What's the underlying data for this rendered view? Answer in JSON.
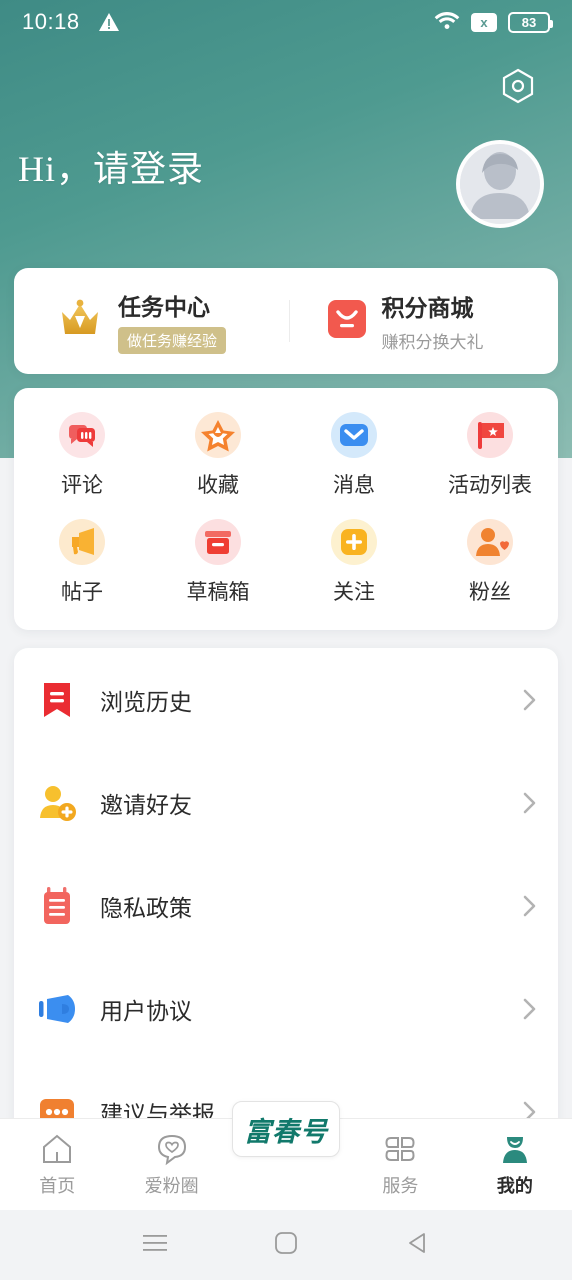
{
  "statusbar": {
    "time": "10:18",
    "warning_icon": "warning-triangle-icon",
    "wifi_icon": "wifi-icon",
    "nosim_label": "x",
    "battery_level": "83"
  },
  "header": {
    "settings_icon": "settings-hexagon-icon",
    "greeting": "Hi，请登录",
    "avatar_icon": "default-avatar-icon",
    "bg_color": "#4e9a90"
  },
  "task_card": {
    "left": {
      "icon": "crown-icon",
      "title": "任务中心",
      "badge": "做任务赚经验"
    },
    "right": {
      "icon": "points-shop-icon",
      "title": "积分商城",
      "subtitle": "赚积分换大礼"
    }
  },
  "grid": {
    "items": [
      {
        "label": "评论",
        "icon": "comment-icon",
        "color": "#f25555"
      },
      {
        "label": "收藏",
        "icon": "star-icon",
        "color": "#f58634"
      },
      {
        "label": "消息",
        "icon": "message-envelope-icon",
        "color": "#3b8ef0"
      },
      {
        "label": "活动列表",
        "icon": "flag-icon",
        "color": "#f04a4a"
      },
      {
        "label": "帖子",
        "icon": "megaphone-icon",
        "color": "#f7a827"
      },
      {
        "label": "草稿箱",
        "icon": "draft-box-icon",
        "color": "#ef3e33"
      },
      {
        "label": "关注",
        "icon": "plus-square-icon",
        "color": "#f9b320"
      },
      {
        "label": "粉丝",
        "icon": "fans-person-icon",
        "color": "#f08330"
      }
    ]
  },
  "menu": {
    "items": [
      {
        "label": "浏览历史",
        "icon": "bookmark-history-icon",
        "chevron": "chevron-right-icon"
      },
      {
        "label": "邀请好友",
        "icon": "invite-friend-icon",
        "chevron": "chevron-right-icon"
      },
      {
        "label": "隐私政策",
        "icon": "privacy-clipboard-icon",
        "chevron": "chevron-right-icon"
      },
      {
        "label": "用户协议",
        "icon": "user-agreement-icon",
        "chevron": "chevron-right-icon"
      },
      {
        "label": "建议与举报",
        "icon": "feedback-dots-icon",
        "chevron": "chevron-right-icon"
      }
    ]
  },
  "tabbar": {
    "logo_text": "富春号",
    "items": [
      {
        "label": "首页",
        "icon": "home-icon",
        "active": false
      },
      {
        "label": "爱粉圈",
        "icon": "heart-bubble-icon",
        "active": false
      },
      {
        "label": "服务",
        "icon": "grid-clover-icon",
        "active": false
      },
      {
        "label": "我的",
        "icon": "profile-person-icon",
        "active": true
      }
    ],
    "active_color": "#2b8a7e"
  },
  "navbar": {
    "recents_icon": "menu-lines-icon",
    "home_icon": "home-square-icon",
    "back_icon": "back-triangle-icon"
  }
}
